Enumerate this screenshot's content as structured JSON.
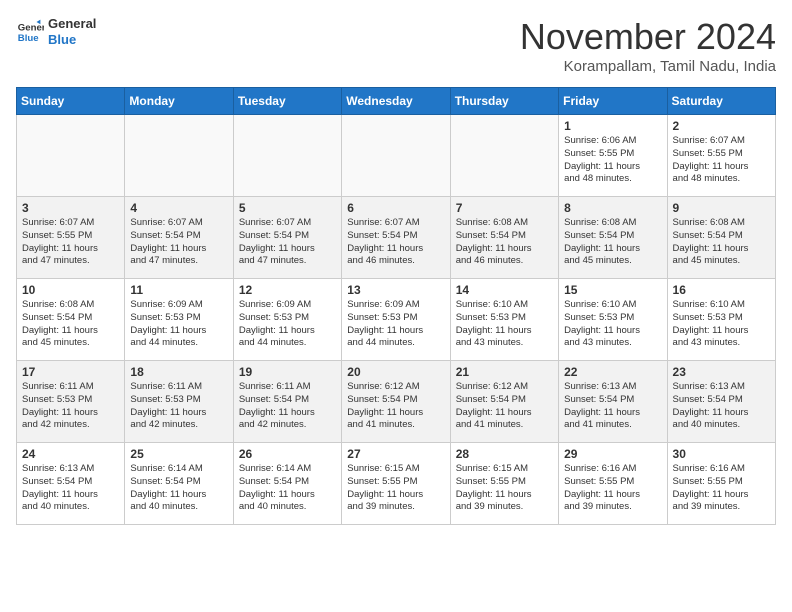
{
  "header": {
    "logo_line1": "General",
    "logo_line2": "Blue",
    "month_title": "November 2024",
    "location": "Korampallam, Tamil Nadu, India"
  },
  "weekdays": [
    "Sunday",
    "Monday",
    "Tuesday",
    "Wednesday",
    "Thursday",
    "Friday",
    "Saturday"
  ],
  "weeks": [
    [
      {
        "day": "",
        "info": ""
      },
      {
        "day": "",
        "info": ""
      },
      {
        "day": "",
        "info": ""
      },
      {
        "day": "",
        "info": ""
      },
      {
        "day": "",
        "info": ""
      },
      {
        "day": "1",
        "info": "Sunrise: 6:06 AM\nSunset: 5:55 PM\nDaylight: 11 hours\nand 48 minutes."
      },
      {
        "day": "2",
        "info": "Sunrise: 6:07 AM\nSunset: 5:55 PM\nDaylight: 11 hours\nand 48 minutes."
      }
    ],
    [
      {
        "day": "3",
        "info": "Sunrise: 6:07 AM\nSunset: 5:55 PM\nDaylight: 11 hours\nand 47 minutes."
      },
      {
        "day": "4",
        "info": "Sunrise: 6:07 AM\nSunset: 5:54 PM\nDaylight: 11 hours\nand 47 minutes."
      },
      {
        "day": "5",
        "info": "Sunrise: 6:07 AM\nSunset: 5:54 PM\nDaylight: 11 hours\nand 47 minutes."
      },
      {
        "day": "6",
        "info": "Sunrise: 6:07 AM\nSunset: 5:54 PM\nDaylight: 11 hours\nand 46 minutes."
      },
      {
        "day": "7",
        "info": "Sunrise: 6:08 AM\nSunset: 5:54 PM\nDaylight: 11 hours\nand 46 minutes."
      },
      {
        "day": "8",
        "info": "Sunrise: 6:08 AM\nSunset: 5:54 PM\nDaylight: 11 hours\nand 45 minutes."
      },
      {
        "day": "9",
        "info": "Sunrise: 6:08 AM\nSunset: 5:54 PM\nDaylight: 11 hours\nand 45 minutes."
      }
    ],
    [
      {
        "day": "10",
        "info": "Sunrise: 6:08 AM\nSunset: 5:54 PM\nDaylight: 11 hours\nand 45 minutes."
      },
      {
        "day": "11",
        "info": "Sunrise: 6:09 AM\nSunset: 5:53 PM\nDaylight: 11 hours\nand 44 minutes."
      },
      {
        "day": "12",
        "info": "Sunrise: 6:09 AM\nSunset: 5:53 PM\nDaylight: 11 hours\nand 44 minutes."
      },
      {
        "day": "13",
        "info": "Sunrise: 6:09 AM\nSunset: 5:53 PM\nDaylight: 11 hours\nand 44 minutes."
      },
      {
        "day": "14",
        "info": "Sunrise: 6:10 AM\nSunset: 5:53 PM\nDaylight: 11 hours\nand 43 minutes."
      },
      {
        "day": "15",
        "info": "Sunrise: 6:10 AM\nSunset: 5:53 PM\nDaylight: 11 hours\nand 43 minutes."
      },
      {
        "day": "16",
        "info": "Sunrise: 6:10 AM\nSunset: 5:53 PM\nDaylight: 11 hours\nand 43 minutes."
      }
    ],
    [
      {
        "day": "17",
        "info": "Sunrise: 6:11 AM\nSunset: 5:53 PM\nDaylight: 11 hours\nand 42 minutes."
      },
      {
        "day": "18",
        "info": "Sunrise: 6:11 AM\nSunset: 5:53 PM\nDaylight: 11 hours\nand 42 minutes."
      },
      {
        "day": "19",
        "info": "Sunrise: 6:11 AM\nSunset: 5:54 PM\nDaylight: 11 hours\nand 42 minutes."
      },
      {
        "day": "20",
        "info": "Sunrise: 6:12 AM\nSunset: 5:54 PM\nDaylight: 11 hours\nand 41 minutes."
      },
      {
        "day": "21",
        "info": "Sunrise: 6:12 AM\nSunset: 5:54 PM\nDaylight: 11 hours\nand 41 minutes."
      },
      {
        "day": "22",
        "info": "Sunrise: 6:13 AM\nSunset: 5:54 PM\nDaylight: 11 hours\nand 41 minutes."
      },
      {
        "day": "23",
        "info": "Sunrise: 6:13 AM\nSunset: 5:54 PM\nDaylight: 11 hours\nand 40 minutes."
      }
    ],
    [
      {
        "day": "24",
        "info": "Sunrise: 6:13 AM\nSunset: 5:54 PM\nDaylight: 11 hours\nand 40 minutes."
      },
      {
        "day": "25",
        "info": "Sunrise: 6:14 AM\nSunset: 5:54 PM\nDaylight: 11 hours\nand 40 minutes."
      },
      {
        "day": "26",
        "info": "Sunrise: 6:14 AM\nSunset: 5:54 PM\nDaylight: 11 hours\nand 40 minutes."
      },
      {
        "day": "27",
        "info": "Sunrise: 6:15 AM\nSunset: 5:55 PM\nDaylight: 11 hours\nand 39 minutes."
      },
      {
        "day": "28",
        "info": "Sunrise: 6:15 AM\nSunset: 5:55 PM\nDaylight: 11 hours\nand 39 minutes."
      },
      {
        "day": "29",
        "info": "Sunrise: 6:16 AM\nSunset: 5:55 PM\nDaylight: 11 hours\nand 39 minutes."
      },
      {
        "day": "30",
        "info": "Sunrise: 6:16 AM\nSunset: 5:55 PM\nDaylight: 11 hours\nand 39 minutes."
      }
    ]
  ]
}
